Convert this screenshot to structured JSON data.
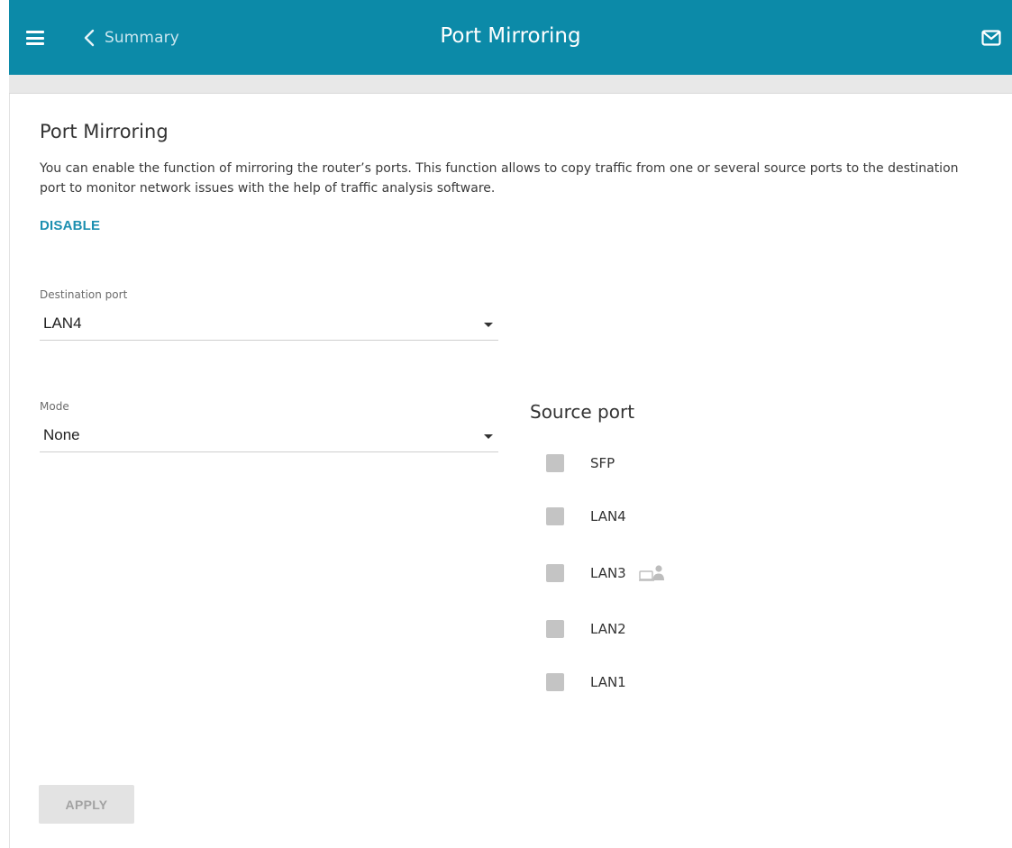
{
  "header": {
    "back_label": "Summary",
    "title": "Port Mirroring",
    "accent_color": "#0c8aa8"
  },
  "section": {
    "title": "Port Mirroring",
    "description": "You can enable the function of mirroring the router’s ports. This function allows to copy traffic from one or several source ports to the destination port to monitor network issues with the help of traffic analysis software.",
    "disable_label": "DISABLE"
  },
  "destination_port": {
    "label": "Destination port",
    "value": "LAN4"
  },
  "mode": {
    "label": "Mode",
    "value": "None"
  },
  "source_port": {
    "title": "Source port",
    "ports": [
      {
        "label": "SFP",
        "checked": false,
        "client_icon": false
      },
      {
        "label": "LAN4",
        "checked": false,
        "client_icon": false
      },
      {
        "label": "LAN3",
        "checked": false,
        "client_icon": true
      },
      {
        "label": "LAN2",
        "checked": false,
        "client_icon": false
      },
      {
        "label": "LAN1",
        "checked": false,
        "client_icon": false
      }
    ]
  },
  "actions": {
    "apply_label": "APPLY"
  },
  "icons": {
    "menu": "hamburger-menu-icon",
    "back": "chevron-left-icon",
    "mail": "envelope-icon",
    "caret": "caret-down-icon",
    "client": "laptop-user-icon"
  }
}
